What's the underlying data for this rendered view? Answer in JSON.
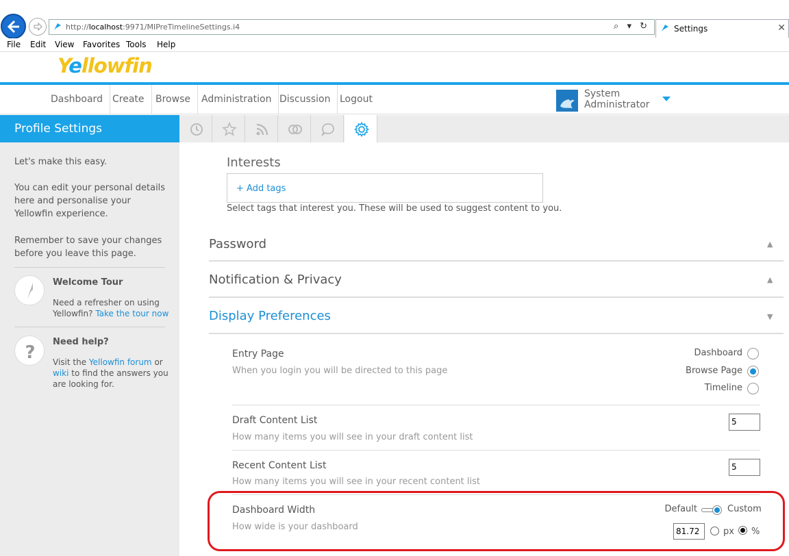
{
  "browser": {
    "url_prefix": "http://",
    "url_host": "localhost",
    "url_rest": ":9971/MIPreTimelineSettings.i4",
    "tab_title": "Settings",
    "tools_glyphs": "⌕ ▾ ↻"
  },
  "menu_bar": {
    "items": [
      "File",
      "Edit",
      "View",
      "Favorites",
      "Tools",
      "Help"
    ]
  },
  "app": {
    "logo_part1": "Y",
    "logo_part2": "e",
    "logo_part3": "llowfin",
    "accent": "#1ba3e8",
    "logo_yellow": "#f4c21a"
  },
  "nav": {
    "items": [
      "Dashboard",
      "Create",
      "Browse",
      "Administration",
      "Discussion",
      "Logout"
    ],
    "user_line1": "System",
    "user_line2": "Administrator"
  },
  "sidebar": {
    "title": "Profile Settings",
    "intro1": "Let's make this easy.",
    "intro2": "You can edit your personal details here and personalise your Yellowfin experience.",
    "intro3": "Remember to save your changes before you leave this page.",
    "tour_title": "Welcome Tour",
    "tour_text": "Need a refresher on using Yellowfin?",
    "tour_link": "Take the tour now",
    "help_title": "Need help?",
    "help_text1": "Visit the",
    "help_link1": "Yellowfin forum",
    "help_text2": "or",
    "help_link2": "wiki",
    "help_text3": "to find the answers you are looking for."
  },
  "tabs": {
    "icons": [
      "history-icon",
      "star-icon",
      "rss-icon",
      "rings-icon",
      "comment-icon",
      "gear-icon"
    ],
    "active": "gear-icon"
  },
  "interests": {
    "heading": "Interests",
    "add_tags": "+ Add tags",
    "help": "Select tags that interest you. These will be used to suggest content to you."
  },
  "sections": {
    "password": "Password",
    "notification": "Notification & Privacy",
    "display": "Display Preferences",
    "chev_up": "▲",
    "chev_down": "▼"
  },
  "display_prefs": {
    "entry_page": {
      "label": "Entry Page",
      "help": "When you login you will be directed to this page",
      "options": [
        "Dashboard",
        "Browse Page",
        "Timeline"
      ],
      "selected": "Browse Page"
    },
    "draft": {
      "label": "Draft Content List",
      "help": "How many items you will see in your draft content list",
      "value": "5"
    },
    "recent": {
      "label": "Recent Content List",
      "help": "How many items you will see in your recent content list",
      "value": "5"
    },
    "width": {
      "label": "Dashboard Width",
      "help": "How wide is your dashboard",
      "toggle_left": "Default",
      "toggle_right": "Custom",
      "toggle_state": "Custom",
      "value": "81.72",
      "unit_px": "px",
      "unit_pct": "%",
      "unit_selected": "%"
    }
  },
  "highlight_color": "#e0181f"
}
